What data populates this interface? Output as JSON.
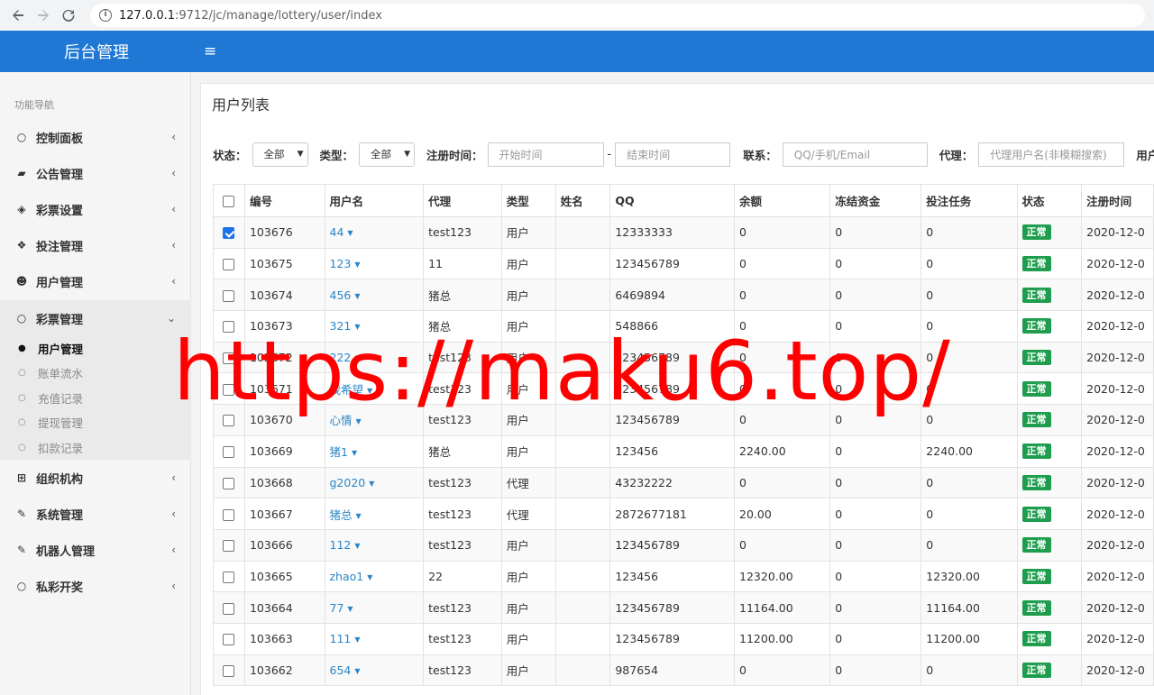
{
  "browser": {
    "url_host": "127.0.0.1",
    "url_path": ":9712/jc/manage/lottery/user/index",
    "back_icon": "arrow-left-icon",
    "forward_icon": "arrow-right-icon",
    "reload_icon": "reload-icon"
  },
  "header": {
    "brand": "后台管理",
    "menu_toggle": "≡"
  },
  "sidebar": {
    "heading": "功能导航",
    "items": [
      {
        "label": "控制面板",
        "icon": "circle-icon",
        "glyph": "○"
      },
      {
        "label": "公告管理",
        "icon": "book-icon",
        "glyph": "▰"
      },
      {
        "label": "彩票设置",
        "icon": "tag-icon",
        "glyph": "◈"
      },
      {
        "label": "投注管理",
        "icon": "bug-icon",
        "glyph": "❖"
      },
      {
        "label": "用户管理",
        "icon": "users-icon",
        "glyph": "☻"
      },
      {
        "label": "彩票管理",
        "icon": "circle-icon",
        "glyph": "○"
      },
      {
        "label": "组织机构",
        "icon": "sitemap-icon",
        "glyph": "⊞"
      },
      {
        "label": "系统管理",
        "icon": "wrench-icon",
        "glyph": "✎"
      },
      {
        "label": "机器人管理",
        "icon": "wrench-icon",
        "glyph": "✎"
      },
      {
        "label": "私彩开奖",
        "icon": "circle-icon",
        "glyph": "○"
      }
    ],
    "sub_items": [
      {
        "label": "用户管理",
        "active": true
      },
      {
        "label": "账单流水"
      },
      {
        "label": "充值记录"
      },
      {
        "label": "提现管理"
      },
      {
        "label": "扣款记录"
      }
    ]
  },
  "page": {
    "title": "用户列表"
  },
  "filters": {
    "status_label": "状态：",
    "status_value": "全部",
    "type_label": "类型：",
    "type_value": "全部",
    "reg_label": "注册时间：",
    "start_placeholder": "开始时间",
    "sep": "-",
    "end_placeholder": "结束时间",
    "contact_label": "联系：",
    "contact_placeholder": "QQ/手机/Email",
    "agent_label": "代理：",
    "agent_placeholder": "代理用户名(非模糊搜索)",
    "user_label": "用户"
  },
  "table": {
    "headers": [
      "编号",
      "用户名",
      "代理",
      "类型",
      "姓名",
      "QQ",
      "余额",
      "冻结资金",
      "投注任务",
      "状态",
      "注册时间"
    ],
    "status_text": "正常",
    "rows": [
      {
        "id": "103676",
        "user": "44",
        "agent": "test123",
        "type": "用户",
        "name": "",
        "qq": "12333333",
        "bal": "0",
        "frozen": "0",
        "task": "0",
        "reg": "2020-12-0",
        "checked": true
      },
      {
        "id": "103675",
        "user": "123",
        "agent": "11",
        "type": "用户",
        "name": "",
        "qq": "123456789",
        "bal": "0",
        "frozen": "0",
        "task": "0",
        "reg": "2020-12-0"
      },
      {
        "id": "103674",
        "user": "456",
        "agent": "猪总",
        "type": "用户",
        "name": "",
        "qq": "6469894",
        "bal": "0",
        "frozen": "0",
        "task": "0",
        "reg": "2020-12-0"
      },
      {
        "id": "103673",
        "user": "321",
        "agent": "猪总",
        "type": "用户",
        "name": "",
        "qq": "548866",
        "bal": "0",
        "frozen": "0",
        "task": "0",
        "reg": "2020-12-0"
      },
      {
        "id": "103672",
        "user": "222",
        "agent": "test123",
        "type": "用户",
        "name": "",
        "qq": "123456789",
        "bal": "0",
        "frozen": "0",
        "task": "0",
        "reg": "2020-12-0"
      },
      {
        "id": "103671",
        "user": "我希望",
        "agent": "test123",
        "type": "用户",
        "name": "",
        "qq": "123456789",
        "bal": "0",
        "frozen": "0",
        "task": "0",
        "reg": "2020-12-0"
      },
      {
        "id": "103670",
        "user": "心情",
        "agent": "test123",
        "type": "用户",
        "name": "",
        "qq": "123456789",
        "bal": "0",
        "frozen": "0",
        "task": "0",
        "reg": "2020-12-0"
      },
      {
        "id": "103669",
        "user": "猪1",
        "agent": "猪总",
        "type": "用户",
        "name": "",
        "qq": "123456",
        "bal": "2240.00",
        "frozen": "0",
        "task": "2240.00",
        "reg": "2020-12-0"
      },
      {
        "id": "103668",
        "user": "g2020",
        "agent": "test123",
        "type": "代理",
        "name": "",
        "qq": "43232222",
        "bal": "0",
        "frozen": "0",
        "task": "0",
        "reg": "2020-12-0"
      },
      {
        "id": "103667",
        "user": "猪总",
        "agent": "test123",
        "type": "代理",
        "name": "",
        "qq": "2872677181",
        "bal": "20.00",
        "frozen": "0",
        "task": "0",
        "reg": "2020-12-0"
      },
      {
        "id": "103666",
        "user": "112",
        "agent": "test123",
        "type": "用户",
        "name": "",
        "qq": "123456789",
        "bal": "0",
        "frozen": "0",
        "task": "0",
        "reg": "2020-12-0"
      },
      {
        "id": "103665",
        "user": "zhao1",
        "agent": "22",
        "type": "用户",
        "name": "",
        "qq": "123456",
        "bal": "12320.00",
        "frozen": "0",
        "task": "12320.00",
        "reg": "2020-12-0"
      },
      {
        "id": "103664",
        "user": "77",
        "agent": "test123",
        "type": "用户",
        "name": "",
        "qq": "123456789",
        "bal": "11164.00",
        "frozen": "0",
        "task": "11164.00",
        "reg": "2020-12-0"
      },
      {
        "id": "103663",
        "user": "111",
        "agent": "test123",
        "type": "用户",
        "name": "",
        "qq": "123456789",
        "bal": "11200.00",
        "frozen": "0",
        "task": "11200.00",
        "reg": "2020-12-0"
      },
      {
        "id": "103662",
        "user": "654",
        "agent": "test123",
        "type": "用户",
        "name": "",
        "qq": "987654",
        "bal": "0",
        "frozen": "0",
        "task": "0",
        "reg": "2020-12-0"
      }
    ]
  },
  "watermark": "https://maku6.top/"
}
